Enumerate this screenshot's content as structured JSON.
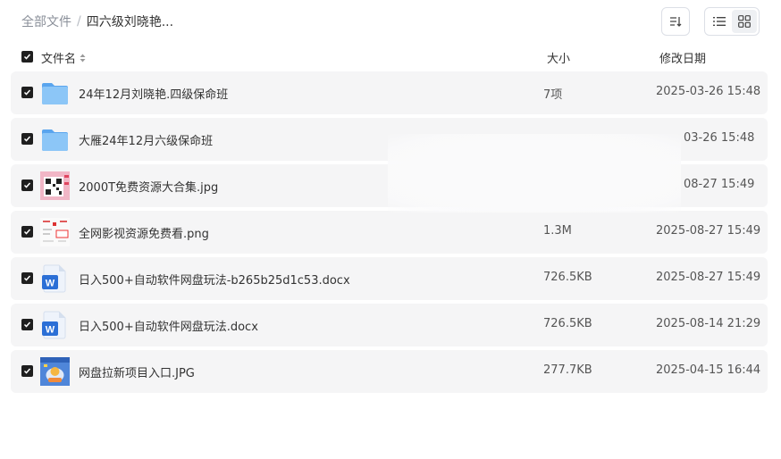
{
  "breadcrumb": {
    "root": "全部文件",
    "separator": "/",
    "current": "四六级刘晓艳..."
  },
  "toolbar": {
    "sort_icon": "sort-icon",
    "list_view_icon": "list-view-icon",
    "grid_view_icon": "grid-view-icon",
    "active_view": "grid"
  },
  "table": {
    "headers": {
      "name": "文件名",
      "size": "大小",
      "date": "修改日期"
    },
    "rows": [
      {
        "name": "24年12月刘晓艳.四级保命班",
        "size": "7项",
        "date": "2025-03-26 15:48",
        "icon": "folder-icon",
        "checked": true
      },
      {
        "name": "大雁24年12月六级保命班",
        "size": "",
        "date": "03-26 15:48",
        "icon": "folder-icon",
        "checked": true
      },
      {
        "name": "2000T免费资源大合集.jpg",
        "size": "",
        "date": "08-27 15:49",
        "icon": "image-thumbnail",
        "checked": true
      },
      {
        "name": "全网影视资源免费看.png",
        "size": "1.3M",
        "date": "2025-08-27 15:49",
        "icon": "image-thumbnail",
        "checked": true
      },
      {
        "name": "日入500+自动软件网盘玩法-b265b25d1c53.docx",
        "size": "726.5KB",
        "date": "2025-08-27 15:49",
        "icon": "word-doc-icon",
        "checked": true
      },
      {
        "name": "日入500+自动软件网盘玩法.docx",
        "size": "726.5KB",
        "date": "2025-08-14 21:29",
        "icon": "word-doc-icon",
        "checked": true
      },
      {
        "name": "网盘拉新项目入口.JPG",
        "size": "277.7KB",
        "date": "2025-04-15 16:44",
        "icon": "image-thumbnail",
        "checked": true
      }
    ]
  },
  "colors": {
    "row_bg": "#f5f5f6",
    "folder": "#7ab9f2",
    "word": "#2b6fd6",
    "checkbox": "#1f1f1f"
  }
}
